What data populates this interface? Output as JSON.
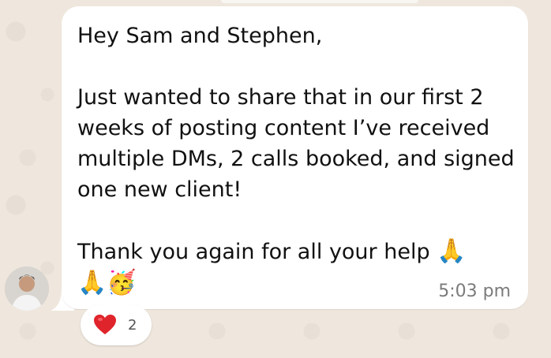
{
  "message": {
    "line1": "Hey Sam and Stephen,",
    "line2": "Just wanted to share that in our first 2 weeks of posting content I’ve received multiple DMs, 2 calls booked, and signed one new client!",
    "line3": "Thank you again for all your help",
    "time": "5:03 pm"
  },
  "reaction": {
    "emoji": "heart-emoji",
    "count": "2"
  },
  "icons": [
    "praying-hands-emoji",
    "praying-hands-emoji",
    "partying-face-emoji"
  ],
  "colors": {
    "bubble": "#ffffff",
    "background": "#efe7dd",
    "heart": "#e0242b"
  }
}
